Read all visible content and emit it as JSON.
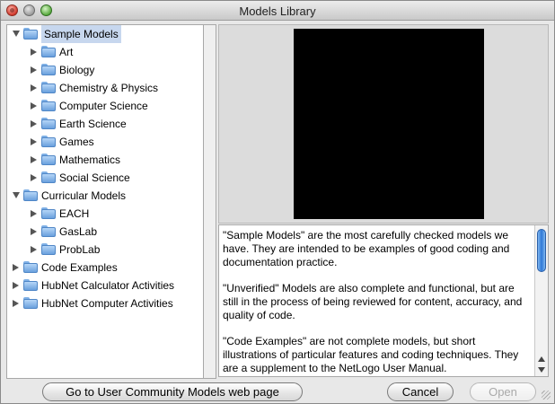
{
  "window": {
    "title": "Models Library"
  },
  "tree": [
    {
      "label": "Sample Models",
      "depth": 0,
      "state": "open",
      "selected": true
    },
    {
      "label": "Art",
      "depth": 1,
      "state": "closed"
    },
    {
      "label": "Biology",
      "depth": 1,
      "state": "closed"
    },
    {
      "label": "Chemistry & Physics",
      "depth": 1,
      "state": "closed"
    },
    {
      "label": "Computer Science",
      "depth": 1,
      "state": "closed"
    },
    {
      "label": "Earth Science",
      "depth": 1,
      "state": "closed"
    },
    {
      "label": "Games",
      "depth": 1,
      "state": "closed"
    },
    {
      "label": "Mathematics",
      "depth": 1,
      "state": "closed"
    },
    {
      "label": "Social Science",
      "depth": 1,
      "state": "closed"
    },
    {
      "label": "Curricular Models",
      "depth": 0,
      "state": "open"
    },
    {
      "label": "EACH",
      "depth": 1,
      "state": "closed"
    },
    {
      "label": "GasLab",
      "depth": 1,
      "state": "closed"
    },
    {
      "label": "ProbLab",
      "depth": 1,
      "state": "closed"
    },
    {
      "label": "Code Examples",
      "depth": 0,
      "state": "closed"
    },
    {
      "label": "HubNet Calculator Activities",
      "depth": 0,
      "state": "closed"
    },
    {
      "label": "HubNet Computer Activities",
      "depth": 0,
      "state": "closed"
    }
  ],
  "description": {
    "p1": "\"Sample Models\" are the most carefully checked models we have. They are intended to be examples of good coding and documentation practice.",
    "p2": "\"Unverified\" Models are also complete and functional, but are still in the process of being reviewed for content, accuracy, and quality of code.",
    "p3": "\"Code Examples\" are not complete models, but short illustrations of particular features and coding techniques. They are a supplement to the NetLogo User Manual."
  },
  "buttons": {
    "community": "Go to User Community Models web page",
    "cancel": "Cancel",
    "open": "Open"
  },
  "colors": {
    "selection": "#c7d7ee",
    "folder": "#6aa0dd",
    "scroll_thumb": "#2f78d6"
  }
}
